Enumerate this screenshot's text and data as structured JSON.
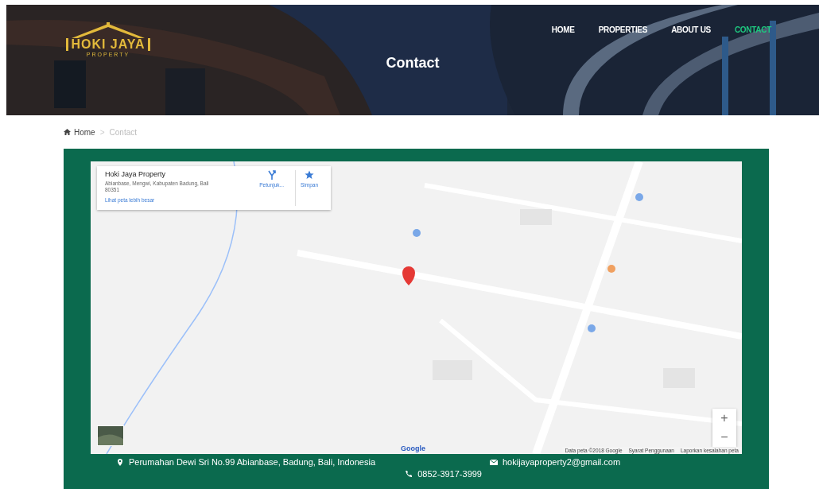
{
  "header": {
    "logo": {
      "title": "HOKI JAYA",
      "subtitle": "PROPERTY"
    },
    "nav": [
      {
        "label": "HOME",
        "selected": false
      },
      {
        "label": "PROPERTIES",
        "selected": false
      },
      {
        "label": "ABOUT US",
        "selected": false
      },
      {
        "label": "CONTACT",
        "selected": true
      }
    ],
    "title": "Contact"
  },
  "breadcrumb": [
    {
      "label": "Home",
      "kind": "home"
    },
    {
      "label": ">",
      "kind": "separator"
    },
    {
      "label": "Contact",
      "kind": "current"
    }
  ],
  "map": {
    "card": {
      "name": "Hoki Jaya Property",
      "address": "Abianbase, Mengwi, Kabupaten Badung, Bali 80351",
      "link": "Lihat peta lebih besar",
      "actions": [
        {
          "label": "Petunjuk...",
          "kind": "directions"
        },
        {
          "label": "Simpan",
          "kind": "save"
        }
      ]
    },
    "zoom": [
      "+",
      "−"
    ],
    "google_logo": "Google",
    "attribution": [
      "Data peta ©2018 Google",
      "Syarat Penggunaan",
      "Laporkan kesalahan peta"
    ]
  },
  "contact": {
    "address": "Perumahan Dewi Sri No.99 Abianbase, Badung, Bali, Indonesia",
    "email": "hokijayaproperty2@gmail.com",
    "phone": "0852-3917-3999"
  }
}
